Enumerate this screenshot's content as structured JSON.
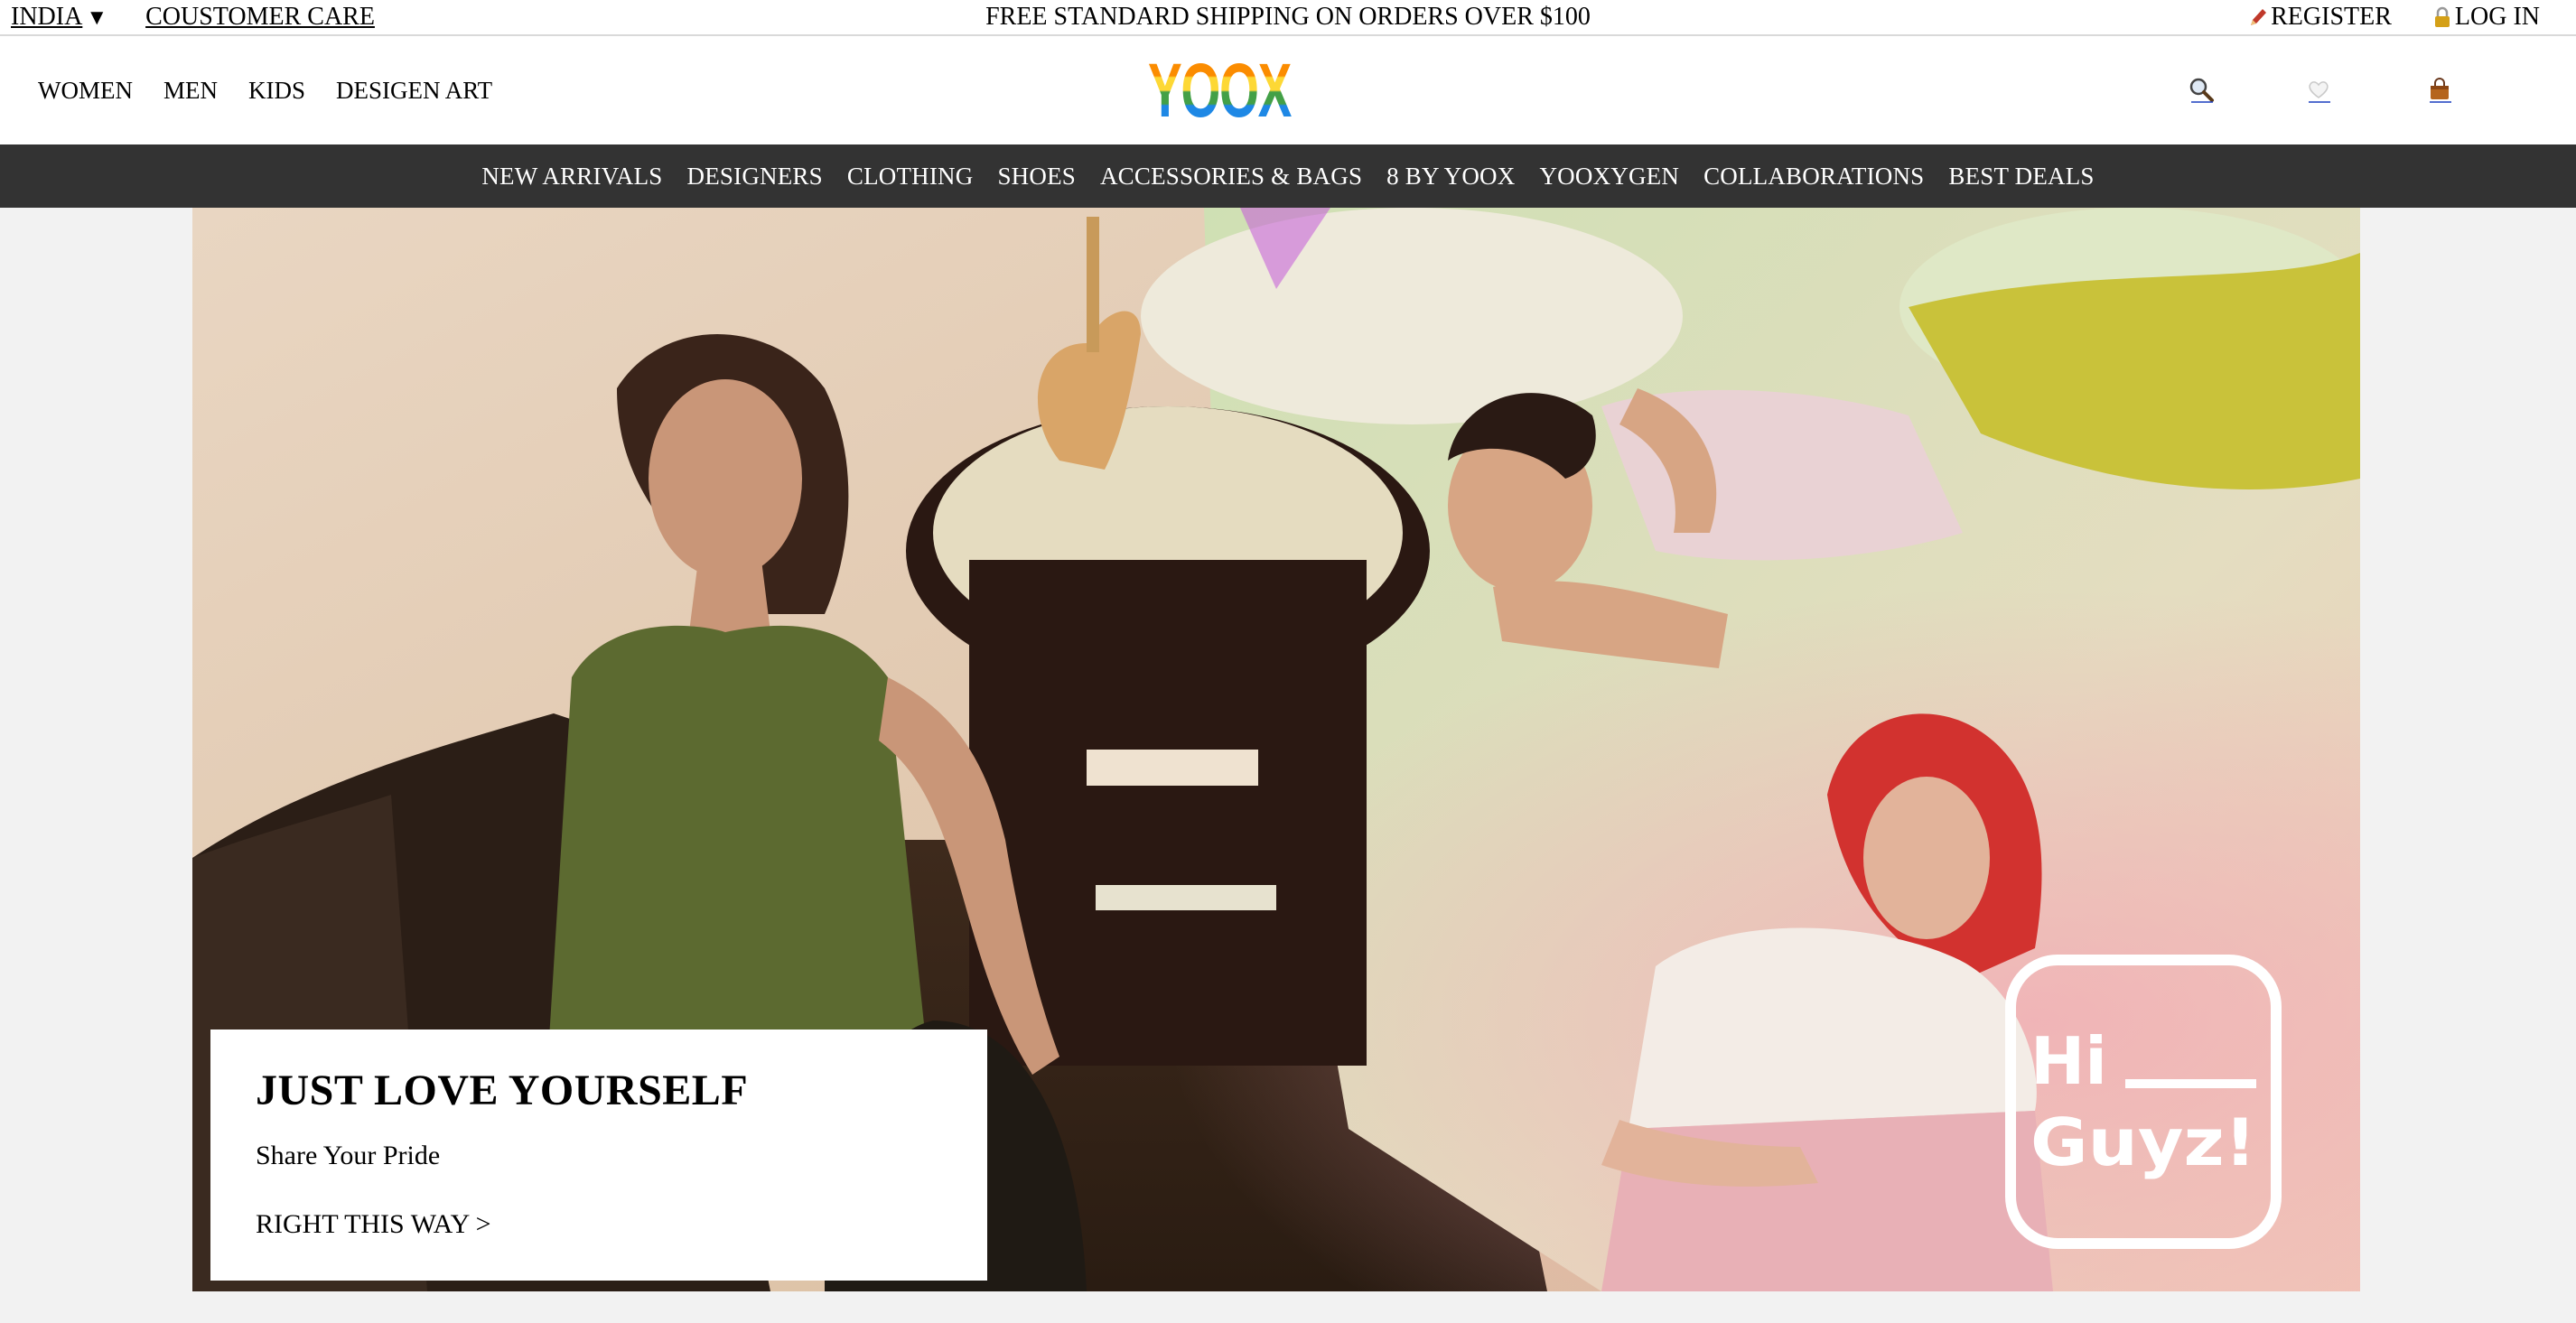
{
  "topbar": {
    "country": "INDIA",
    "customer_care": "COUSTOMER CARE",
    "shipping_notice": "FREE STANDARD SHIPPING ON ORDERS OVER $100",
    "register": "REGISTER",
    "login": "LOG IN"
  },
  "header": {
    "logo": "YOOX",
    "categories": [
      "WOMEN",
      "MEN",
      "KIDS",
      "DESIGEN ART"
    ],
    "icons": [
      "search-icon",
      "heart-icon",
      "bag-icon"
    ]
  },
  "mainnav": {
    "items": [
      "NEW ARRIVALS",
      "DESIGNERS",
      "CLOTHING",
      "SHOES",
      "ACCESSORIES & BAGS",
      "8 BY YOOX",
      "YOOXYGEN",
      "COLLABORATIONS",
      "BEST DEALS"
    ]
  },
  "hero": {
    "title": "JUST LOVE YOURSELF",
    "subtitle": "Share Your Pride",
    "cta": "RIGHT THIS WAY >",
    "badge_line1": "Hi",
    "badge_line2": "Guyz!"
  },
  "colors": {
    "nav_bg": "#333333",
    "page_bg": "#f2f2f2",
    "logo_rainbow": [
      "#e53935",
      "#fb8c00",
      "#fdd835",
      "#43a047",
      "#1e88e5",
      "#8e24aa"
    ]
  }
}
